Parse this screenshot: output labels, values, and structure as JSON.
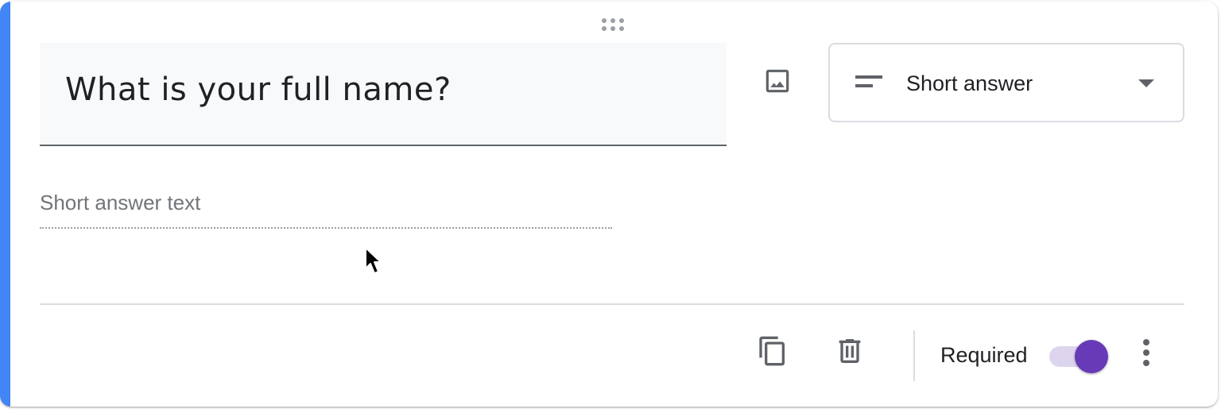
{
  "question": {
    "title": "What is your full name?"
  },
  "question_type": {
    "selected": "Short answer",
    "icon": "short-text-icon"
  },
  "answer": {
    "placeholder": "Short answer text"
  },
  "footer": {
    "duplicate_icon": "copy-icon",
    "delete_icon": "trash-icon",
    "required_label": "Required",
    "required_on": true,
    "more_icon": "more-vert-icon"
  },
  "colors": {
    "accent": "#4285f4",
    "toggle_knob": "#673ab7",
    "toggle_track": "#ddd5ee",
    "icon": "#5f6368"
  }
}
